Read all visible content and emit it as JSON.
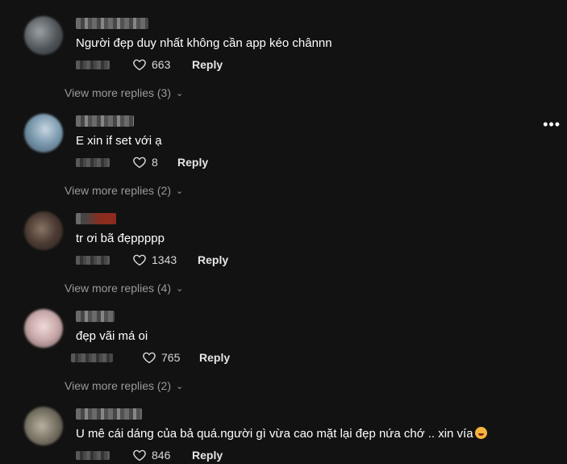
{
  "comments": [
    {
      "text": "Người đẹp duy nhất không cần app kéo chânnn",
      "likes": "663",
      "reply_label": "Reply",
      "more_replies": "View more replies (3)"
    },
    {
      "text": "E xin if set với ạ",
      "likes": "8",
      "reply_label": "Reply",
      "more_replies": "View more replies (2)"
    },
    {
      "text": "tr ơi bã đẹppppp",
      "likes": "1343",
      "reply_label": "Reply",
      "more_replies": "View more replies (4)"
    },
    {
      "text": "đẹp vãi má oi",
      "likes": "765",
      "reply_label": "Reply",
      "more_replies": "View more replies (2)"
    },
    {
      "text": "U mê cái dáng của bả quá.người gì vừa cao mặt lại đẹp nứa chớ .. xin vía",
      "likes": "846",
      "reply_label": "Reply"
    }
  ],
  "menu_icon": "more-horizontal-icon",
  "heart_icon": "heart-outline-icon",
  "chevron_icon": "chevron-down-icon"
}
